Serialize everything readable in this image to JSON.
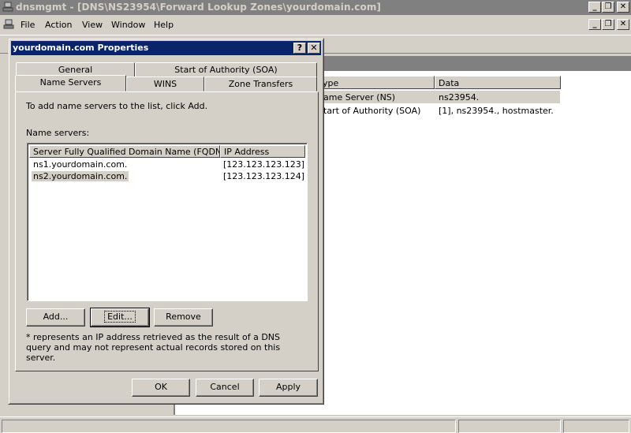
{
  "window": {
    "title": "dnsmgmt - [DNS\\NS23954\\Forward Lookup Zones\\yourdomain.com]",
    "minimize": "_",
    "restore": "❐",
    "close": "✕"
  },
  "menu": {
    "items": [
      "File",
      "Action",
      "View",
      "Window",
      "Help"
    ]
  },
  "right_pane": {
    "columns": [
      "ype",
      "Data"
    ],
    "rows": [
      {
        "type": "ame Server (NS)",
        "data": "ns23954."
      },
      {
        "type": "tart of Authority (SOA)",
        "data": "[1], ns23954., hostmaster."
      }
    ]
  },
  "dialog": {
    "title": "yourdomain.com Properties",
    "help": "?",
    "close": "✕",
    "tabs_row1": [
      "General",
      "Start of Authority (SOA)"
    ],
    "tabs_row2": [
      "Name Servers",
      "WINS",
      "Zone Transfers"
    ],
    "active_tab": "Name Servers",
    "instruction": "To add name servers to the list, click Add.",
    "list_label": "Name servers:",
    "list_columns": [
      "Server Fully Qualified Domain Name (FQDN)",
      "IP Address"
    ],
    "name_servers": [
      {
        "fqdn": "ns1.yourdomain.com.",
        "ip": "[123.123.123.123]"
      },
      {
        "fqdn": "ns2.yourdomain.com.",
        "ip": "[123.123.123.124]"
      }
    ],
    "buttons": {
      "add": "Add...",
      "edit": "Edit...",
      "remove": "Remove"
    },
    "footnote": "* represents an IP address retrieved as the result of a DNS query and may not represent actual records stored on this server.",
    "footer_buttons": {
      "ok": "OK",
      "cancel": "Cancel",
      "apply": "Apply"
    }
  }
}
